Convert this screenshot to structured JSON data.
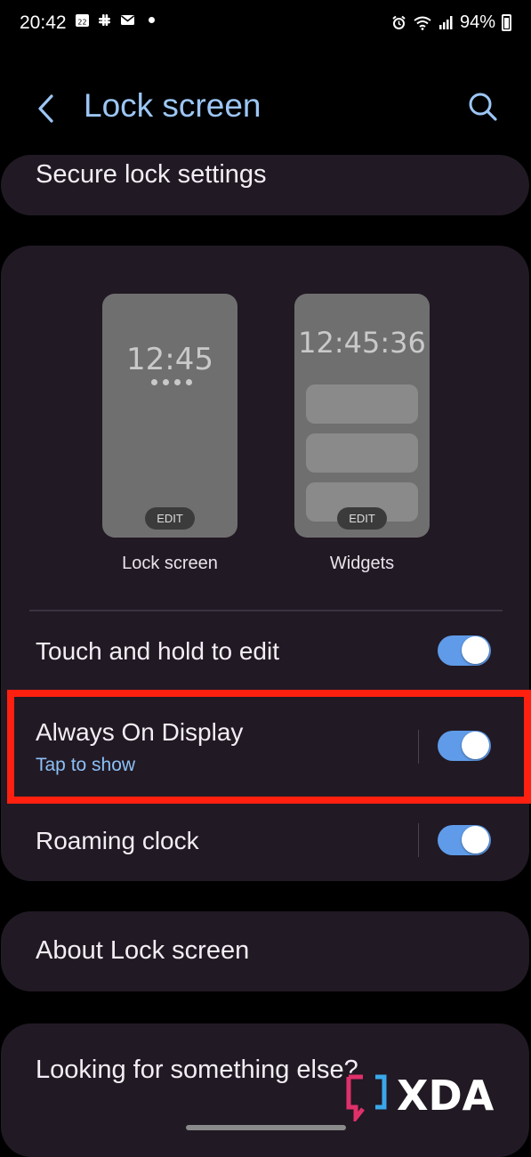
{
  "status_bar": {
    "time": "20:42",
    "calendar_day": "22",
    "battery": "94%"
  },
  "header": {
    "title": "Lock screen"
  },
  "secure_lock": {
    "label": "Secure lock settings"
  },
  "previews": [
    {
      "clock": "12:45",
      "edit_label": "EDIT",
      "caption": "Lock screen"
    },
    {
      "clock": "12:45:36",
      "edit_label": "EDIT",
      "caption": "Widgets"
    }
  ],
  "settings": {
    "touch_hold": {
      "label": "Touch and hold to edit",
      "enabled": true
    },
    "aod": {
      "label": "Always On Display",
      "sublabel": "Tap to show",
      "enabled": true
    },
    "roaming": {
      "label": "Roaming clock",
      "enabled": true
    }
  },
  "about": {
    "label": "About Lock screen"
  },
  "looking": {
    "label": "Looking for something else?"
  },
  "watermark": {
    "text": "XDA"
  },
  "colors": {
    "accent": "#9cc6f5",
    "toggle_on": "#5f9be8",
    "card": "#211924",
    "highlight": "#ff2010"
  }
}
